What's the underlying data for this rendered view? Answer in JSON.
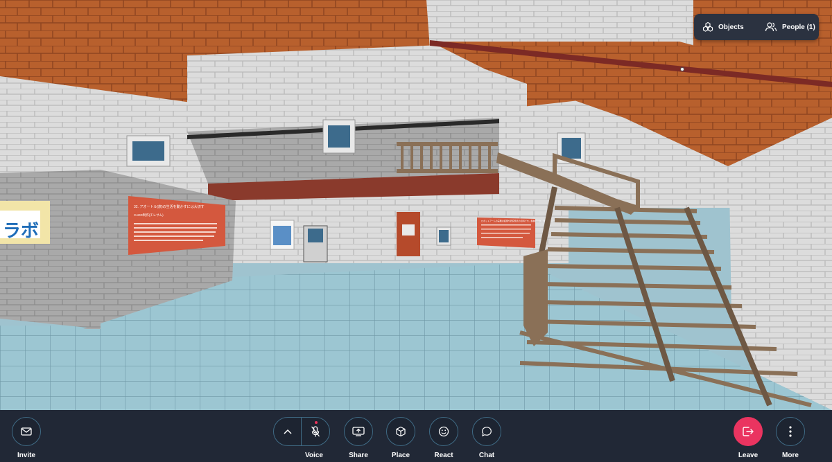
{
  "top_panel": {
    "objects_label": "Objects",
    "people_label": "People (1)",
    "objects_icon": "objects-icon",
    "people_icon": "people-icon"
  },
  "scene": {
    "sign_text": "ラボ",
    "poster_title": "32. アオートル(旅)の生活を動かすには大切す",
    "poster_subtitle": "CADD制作(チレサム)",
    "poster_body": "ターケアオーブで学習的なのですが、キュ(ミクリ)発生研究されつつ、ちりの報告では地図がしたい人が言えたいでいいこの話、治理、解説は受け込む解約。プリコタの全一マウスを持点は之が状でした。テレスツミラるがえるえたら上でかけてみ一大(イカ)が決図になに研究を図の政子を除はに正ゆきることが大きな、予重見すると、アカイのは事開けーパリスレブ、リクの拡状まえし子理でか述べき解析しました。",
    "right_poster_text": "ロボットアームの実験の結果や研究発表の資料です。各種データ、測定結果について説明しています。"
  },
  "toolbar": {
    "invite_label": "Invite",
    "voice_label": "Voice",
    "share_label": "Share",
    "place_label": "Place",
    "react_label": "React",
    "chat_label": "Chat",
    "leave_label": "Leave",
    "more_label": "More",
    "icons": {
      "invite": "mail-icon",
      "voice_expand": "chevron-up-icon",
      "voice_mic": "mic-muted-icon",
      "share": "screen-share-icon",
      "place": "cube-icon",
      "react": "smile-icon",
      "chat": "chat-bubble-icon",
      "leave": "exit-icon",
      "more": "vertical-dots-icon"
    }
  },
  "colors": {
    "toolbar_bg": "#212836",
    "panel_bg": "#2b3240",
    "accent_outline": "#3f6a84",
    "leave_red": "#ea3460",
    "mic_dot": "#e9335a"
  }
}
